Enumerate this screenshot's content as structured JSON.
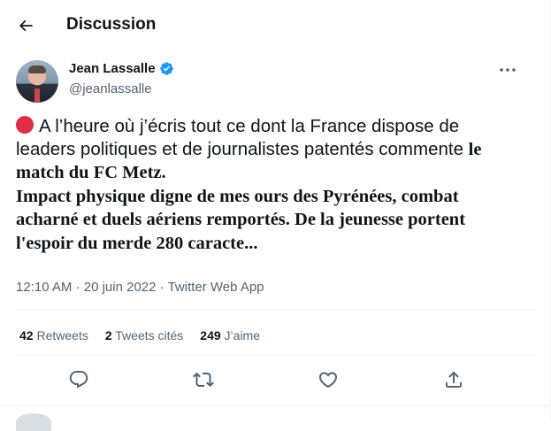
{
  "header": {
    "title": "Discussion"
  },
  "author": {
    "name": "Jean Lassalle",
    "handle": "@jeanlassalle"
  },
  "tweet": {
    "text_regular": "A l’heure où j’écris tout ce dont la France dispose de leaders politiques et de journalistes patentés commente",
    "text_overlay_line1": "le match du FC Metz.",
    "text_overlay_line2": "Impact physique digne de mes ours des Pyrénées, combat acharné et duels aériens remportés. De la jeunesse portent l'espoir du merde 280 caracte..."
  },
  "meta": {
    "time": "12:10 AM",
    "separator": "·",
    "date": "20 juin 2022",
    "separator2": "·",
    "source": "Twitter Web App"
  },
  "stats": [
    {
      "count": "42",
      "label": "Retweets"
    },
    {
      "count": "2",
      "label": "Tweets cités"
    },
    {
      "count": "249",
      "label": "J’aime"
    }
  ],
  "icons": {
    "back": "arrow-left-icon",
    "verified": "verified-badge-icon",
    "more": "more-horizontal-icon",
    "reply": "reply-icon",
    "retweet": "retweet-icon",
    "like": "heart-icon",
    "share": "share-icon"
  },
  "colors": {
    "text": "#0f1419",
    "secondary": "#536471",
    "verified": "#1d9bf0",
    "red_dot": "#dd2e44",
    "border": "#eff3f4"
  }
}
